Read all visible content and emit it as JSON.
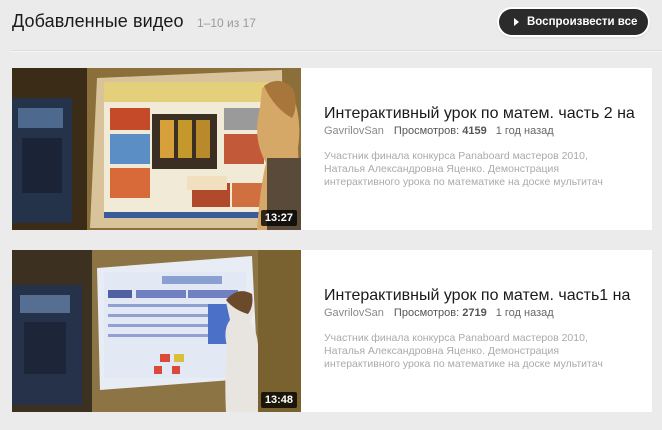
{
  "header": {
    "title": "Добавленные видео",
    "range": "1–10 из 17",
    "play_all_label": "Воспроизвести все"
  },
  "videos": [
    {
      "title": "Интерактивный урок по матем. часть 2 на",
      "author": "GavrilovSan",
      "views_label": "Просмотров:",
      "views_count": "4159",
      "ago": "1 год назад",
      "desc_lines": [
        "Участник финала конкурса Panaboard мастеров 2010,",
        "Наталья Александровна Яценко. Демонстрация",
        "интерактивного урока по математике на доске мультитач"
      ],
      "duration": "13:27"
    },
    {
      "title": "Интерактивный урок по матем. часть1 на",
      "author": "GavrilovSan",
      "views_label": "Просмотров:",
      "views_count": "2719",
      "ago": "1 год назад",
      "desc_lines": [
        "Участник финала конкурса Panaboard мастеров 2010,",
        "Наталья Александровна Яценко. Демонстрация",
        "интерактивного урока по математике на доске мультитач"
      ],
      "duration": "13:48"
    }
  ],
  "colors": {
    "page_bg": "#ebebeb",
    "card_bg": "#ffffff",
    "button_bg": "#2b2b2b",
    "title_text": "#1a1a1a",
    "meta_text": "#888888",
    "desc_text": "#aaaaaa"
  }
}
